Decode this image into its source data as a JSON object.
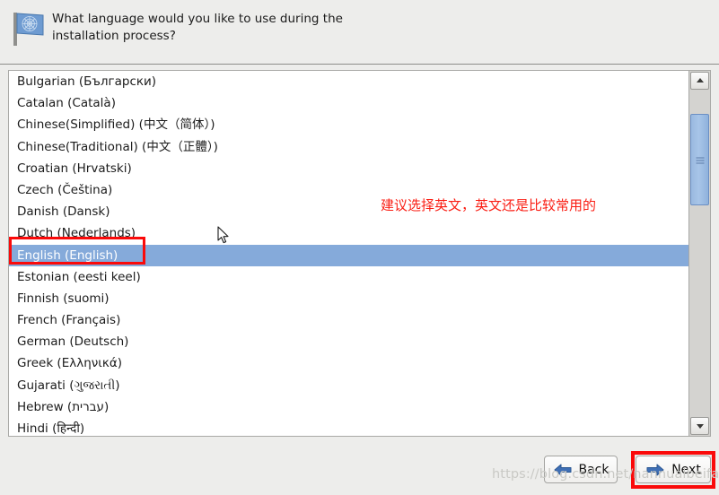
{
  "header": {
    "icon": "un-flag-icon",
    "question": "What language would you like to use during the installation process?"
  },
  "language_list": {
    "items": [
      {
        "label": "Bulgarian (Български)",
        "selected": false
      },
      {
        "label": "Catalan (Català)",
        "selected": false
      },
      {
        "label": "Chinese(Simplified) (中文（简体）)",
        "selected": false
      },
      {
        "label": "Chinese(Traditional) (中文（正體）)",
        "selected": false
      },
      {
        "label": "Croatian (Hrvatski)",
        "selected": false
      },
      {
        "label": "Czech (Čeština)",
        "selected": false
      },
      {
        "label": "Danish (Dansk)",
        "selected": false
      },
      {
        "label": "Dutch (Nederlands)",
        "selected": false
      },
      {
        "label": "English (English)",
        "selected": true
      },
      {
        "label": "Estonian (eesti keel)",
        "selected": false
      },
      {
        "label": "Finnish (suomi)",
        "selected": false
      },
      {
        "label": "French (Français)",
        "selected": false
      },
      {
        "label": "German (Deutsch)",
        "selected": false
      },
      {
        "label": "Greek (Ελληνικά)",
        "selected": false
      },
      {
        "label": "Gujarati (ગુજરાતી)",
        "selected": false
      },
      {
        "label": "Hebrew (עברית)",
        "selected": false
      },
      {
        "label": "Hindi (हिन्दी)",
        "selected": false
      }
    ],
    "selected_value": "English (English)",
    "selection_color": "#85aada"
  },
  "scrollbar": {
    "up_arrow": "chevron-up-icon",
    "down_arrow": "chevron-down-icon",
    "thumb_color": "#9ab9e0"
  },
  "annotations": {
    "note_text": "建议选择英文，英文还是比较常用的",
    "note_color": "#fa1e14",
    "box_color": "#fa0a0a"
  },
  "footer": {
    "back_label": "Back",
    "next_label": "Next",
    "back_icon": "arrow-left-icon",
    "next_icon": "arrow-right-icon"
  },
  "watermark": {
    "text": "https://blog.csdn.net/nannualbeifan"
  }
}
